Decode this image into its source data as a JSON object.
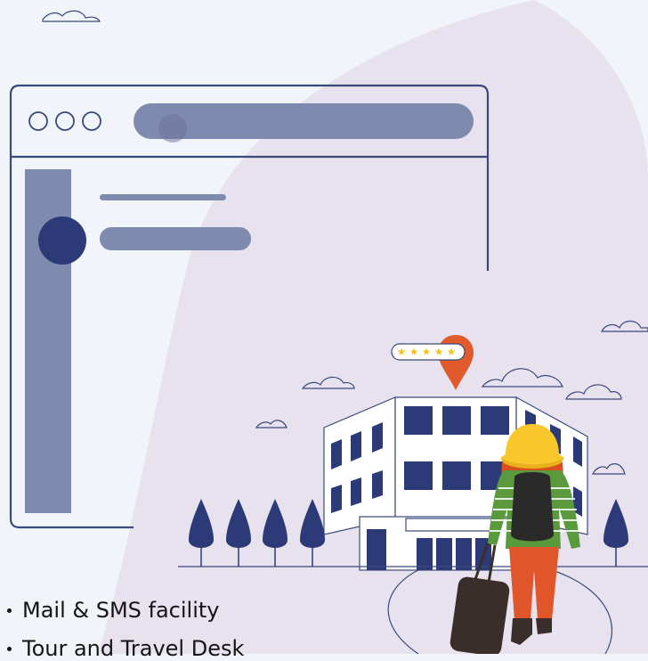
{
  "illustration": {
    "rating_stars": 5,
    "colors": {
      "background": "#f1f5fa",
      "blob": "#e8e2ef",
      "outline": "#3b4a7c",
      "bar": "#7e8aae",
      "navy": "#2c3a78",
      "pin": "#e05a2b",
      "star": "#f5c21a",
      "hat": "#f7c72c",
      "hair": "#d9501e",
      "shirt": "#5a9a3c",
      "pants": "#e0562a",
      "suitcase": "#3a2e2b"
    }
  },
  "features": [
    {
      "text": "Mail & SMS facility"
    },
    {
      "text": "Tour and Travel Desk"
    }
  ]
}
